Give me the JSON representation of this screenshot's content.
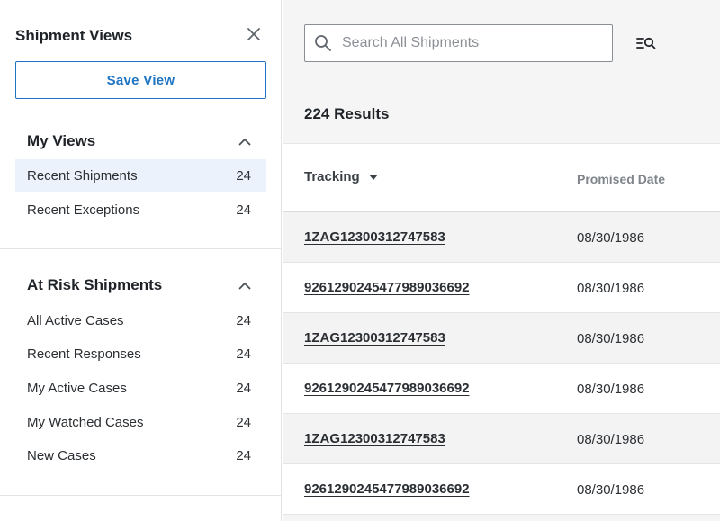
{
  "sidebar": {
    "title": "Shipment Views",
    "save_view_label": "Save View",
    "my_views": {
      "title": "My Views",
      "items": [
        {
          "label": "Recent Shipments",
          "count": "24",
          "active": true
        },
        {
          "label": "Recent Exceptions",
          "count": "24",
          "active": false
        }
      ]
    },
    "at_risk": {
      "title": "At Risk Shipments",
      "items": [
        {
          "label": "All Active Cases",
          "count": "24"
        },
        {
          "label": "Recent Responses",
          "count": "24"
        },
        {
          "label": "My Active Cases",
          "count": "24"
        },
        {
          "label": "My Watched Cases",
          "count": "24"
        },
        {
          "label": "New Cases",
          "count": "24"
        }
      ]
    }
  },
  "main": {
    "search": {
      "placeholder": "Search All Shipments",
      "value": ""
    },
    "results_label": "224 Results",
    "table": {
      "headers": {
        "tracking": "Tracking",
        "promised_date": "Promised Date"
      },
      "rows": [
        {
          "tracking": "1ZAG12300312747583",
          "promised_date": "08/30/1986"
        },
        {
          "tracking": "9261290245477989036692",
          "promised_date": "08/30/1986"
        },
        {
          "tracking": "1ZAG12300312747583",
          "promised_date": "08/30/1986"
        },
        {
          "tracking": "9261290245477989036692",
          "promised_date": "08/30/1986"
        },
        {
          "tracking": "1ZAG12300312747583",
          "promised_date": "08/30/1986"
        },
        {
          "tracking": "9261290245477989036692",
          "promised_date": "08/30/1986"
        }
      ]
    }
  },
  "icons": {
    "close": "close-icon",
    "chevron": "chevron-up-icon",
    "search": "search-icon",
    "filter": "filter-search-icon",
    "sort": "caret-down-icon"
  },
  "colors": {
    "accent": "#1f74c4",
    "active_item_bg": "#ecf2fc",
    "main_bg": "#f5f5f5"
  }
}
